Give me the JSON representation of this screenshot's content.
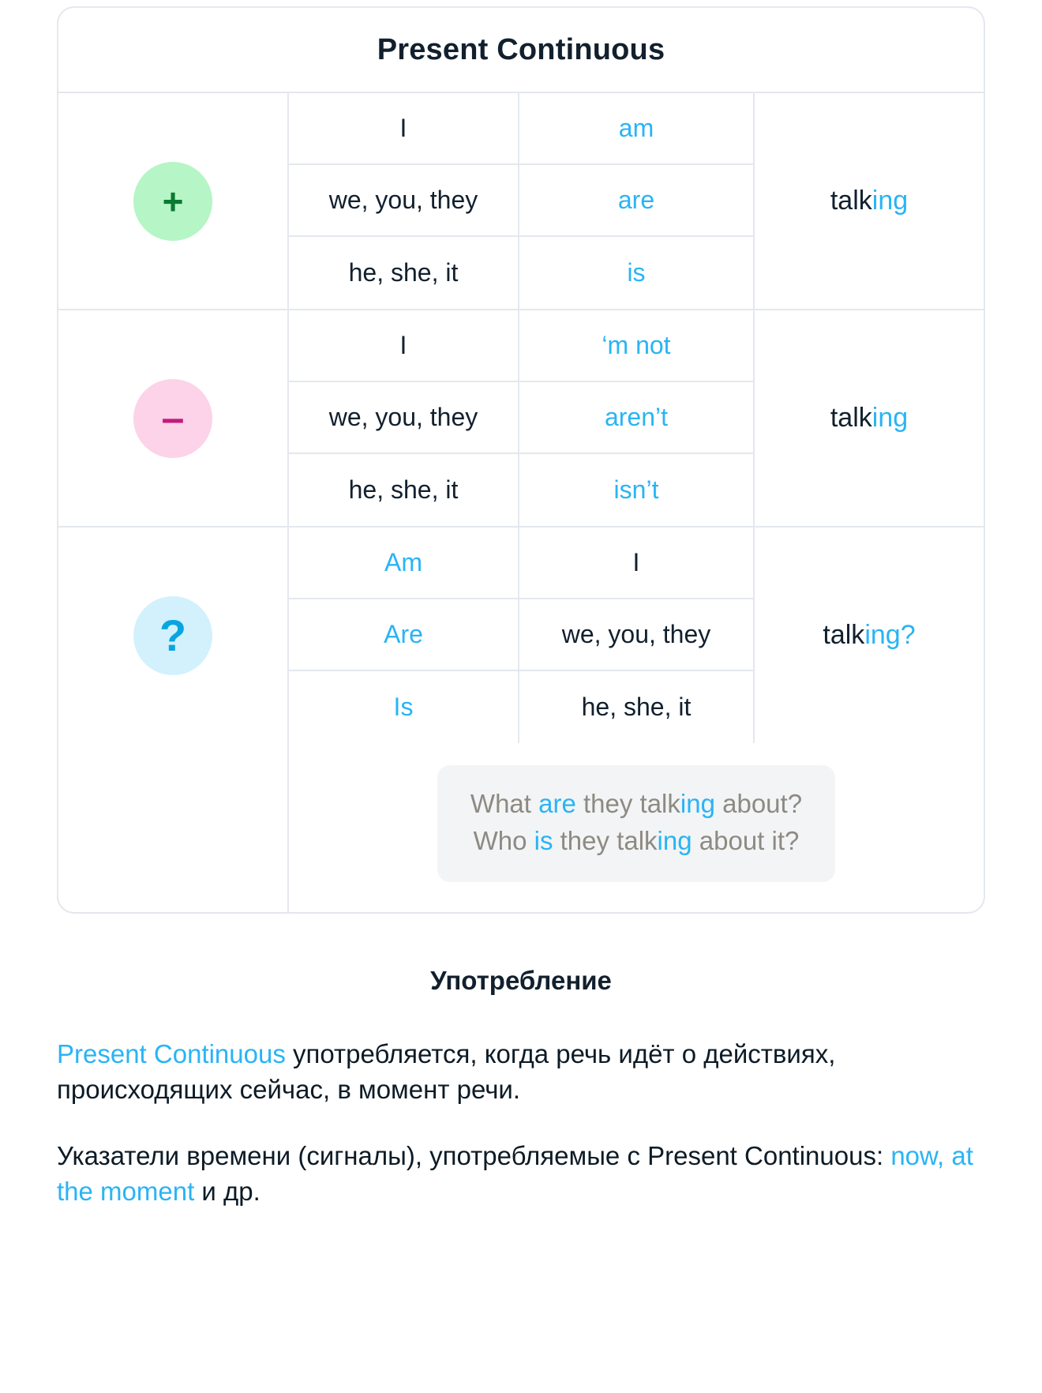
{
  "card": {
    "title": "Present Continuous",
    "sections": [
      {
        "id": "affirmative",
        "badge": {
          "icon": "plus-icon",
          "glyph": "+",
          "bg": "#b6f5c6",
          "fg": "#0b7a33"
        },
        "rows": [
          {
            "subject": "I",
            "aux": "am",
            "aux_color": "blue"
          },
          {
            "subject": "we, you, they",
            "aux": "are",
            "aux_color": "blue"
          },
          {
            "subject": "he, she, it",
            "aux": "is",
            "aux_color": "blue"
          }
        ],
        "verb": {
          "stem": "talk",
          "ending": "ing",
          "tail": ""
        }
      },
      {
        "id": "negative",
        "badge": {
          "icon": "minus-icon",
          "glyph": "–",
          "bg": "#fcd3e8",
          "fg": "#c21b7c"
        },
        "rows": [
          {
            "subject": "I",
            "aux": "‘m not",
            "aux_color": "blue"
          },
          {
            "subject": "we, you, they",
            "aux": "aren’t",
            "aux_color": "blue"
          },
          {
            "subject": "he, she, it",
            "aux": "isn’t",
            "aux_color": "blue"
          }
        ],
        "verb": {
          "stem": "talk",
          "ending": "ing",
          "tail": ""
        }
      },
      {
        "id": "question",
        "badge": {
          "icon": "question-mark-icon",
          "glyph": "?",
          "bg": "#d2f1fd",
          "fg": "#0aa5e0"
        },
        "rows": [
          {
            "subject": "Am",
            "subject_color": "blue",
            "aux": "I",
            "aux_color": "dark"
          },
          {
            "subject": "Are",
            "subject_color": "blue",
            "aux": "we, you, they",
            "aux_color": "dark"
          },
          {
            "subject": "Is",
            "subject_color": "blue",
            "aux": "he, she, it",
            "aux_color": "dark"
          }
        ],
        "verb": {
          "stem": "talk",
          "ending": "ing",
          "tail": "?"
        }
      }
    ],
    "examples": [
      {
        "parts": [
          {
            "t": "What ",
            "c": "gray"
          },
          {
            "t": "are",
            "c": "blue"
          },
          {
            "t": " they talk",
            "c": "gray"
          },
          {
            "t": "ing",
            "c": "blue"
          },
          {
            "t": " about?",
            "c": "gray"
          }
        ]
      },
      {
        "parts": [
          {
            "t": "Who ",
            "c": "gray"
          },
          {
            "t": "is",
            "c": "blue"
          },
          {
            "t": " they talk",
            "c": "gray"
          },
          {
            "t": "ing",
            "c": "blue"
          },
          {
            "t": " about it?",
            "c": "gray"
          }
        ]
      }
    ]
  },
  "usage": {
    "title": "Употребление",
    "paragraphs": [
      {
        "parts": [
          {
            "t": "Present Continuous",
            "c": "blue"
          },
          {
            "t": " употребляется, когда речь идёт о действиях, происходящих сейчас, в момент речи.",
            "c": "dark"
          }
        ]
      },
      {
        "parts": [
          {
            "t": "Указатели времени (сигналы), употребляемые с Present Continuous: ",
            "c": "dark"
          },
          {
            "t": "now, at the moment",
            "c": "blue"
          },
          {
            "t": " и др.",
            "c": "dark"
          }
        ]
      }
    ]
  },
  "colors": {
    "accent_blue": "#29b4f5",
    "dark": "#12202e",
    "gray_text": "#8e8a82",
    "border": "#e4e8ee",
    "example_bg": "#f2f4f6"
  }
}
